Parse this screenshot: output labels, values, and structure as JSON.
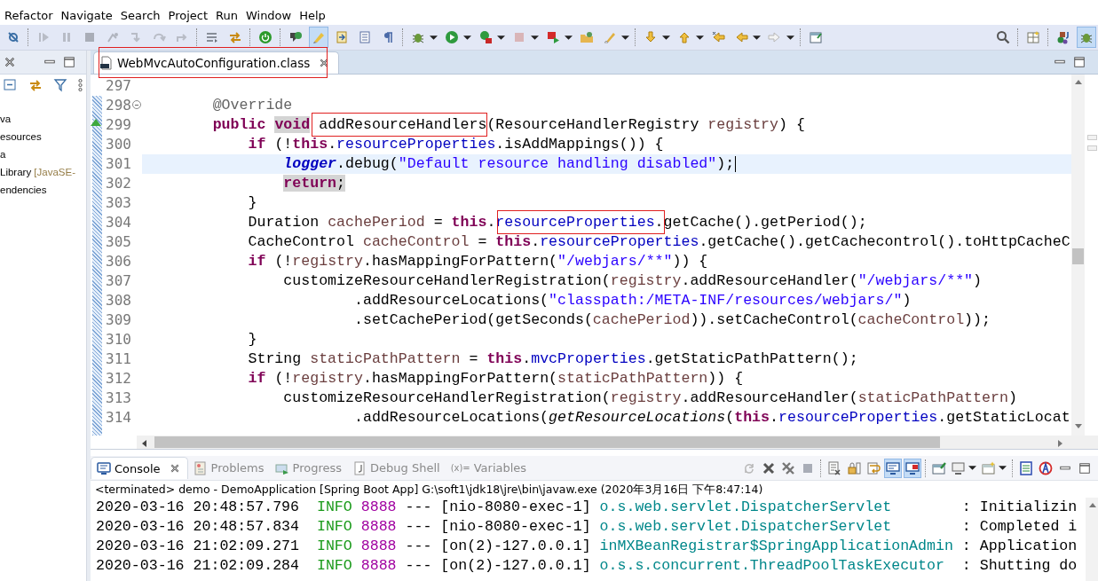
{
  "menu": [
    {
      "label": "Refactor"
    },
    {
      "label": "Navigate"
    },
    {
      "label": "Search"
    },
    {
      "label": "Project"
    },
    {
      "label": "Run"
    },
    {
      "label": "Window"
    },
    {
      "label": "Help"
    }
  ],
  "toolbar": {
    "mark_occurrences": {
      "on": true
    }
  },
  "perspectives": [
    {
      "selected": false
    },
    {
      "selected": false
    },
    {
      "selected": true
    }
  ],
  "left_panel": {
    "items": [
      {
        "text": "va"
      },
      {
        "text": "esources"
      },
      {
        "text": "a"
      },
      {
        "text": " Library",
        "decoration": " [JavaSE-"
      },
      {
        "text": "endencies"
      }
    ]
  },
  "editor": {
    "tabs": [
      {
        "label": "WebMvcAutoConfiguration.class",
        "selected": true,
        "framed": true
      }
    ],
    "lines": [
      {
        "number": "297",
        "current": false
      },
      {
        "number": "298",
        "current": false,
        "fold": {
          "expanded": true
        },
        "tokens": [
          {
            "text": "        @Override",
            "kind": "anno"
          }
        ]
      },
      {
        "number": "299",
        "current": false,
        "override_marker": true,
        "tokens": [
          {
            "text": "        public ",
            "kind": "kw"
          },
          {
            "text": "void",
            "kind": "kw-marked"
          },
          {
            "text": " addResourceHandlers",
            "kind": "plain-framed"
          },
          {
            "text": "(ResourceHandlerRegistry ",
            "kind": "plain"
          },
          {
            "text": "registry",
            "kind": "local"
          },
          {
            "text": ") {",
            "kind": "plain"
          }
        ]
      },
      {
        "number": "300",
        "current": false,
        "tokens": [
          {
            "text": "            if",
            "kind": "kw"
          },
          {
            "text": " (!",
            "kind": "plain"
          },
          {
            "text": "this",
            "kind": "kw"
          },
          {
            "text": ".",
            "kind": "plain"
          },
          {
            "text": "resourceProperties",
            "kind": "field"
          },
          {
            "text": ".isAddMappings()) {",
            "kind": "plain"
          }
        ]
      },
      {
        "number": "301",
        "current": true,
        "tokens": [
          {
            "text": "                logger",
            "kind": "static"
          },
          {
            "text": ".debug(",
            "kind": "plain"
          },
          {
            "text": "\"Default resource handling disabled\"",
            "kind": "str"
          },
          {
            "text": ");",
            "kind": "plain"
          }
        ]
      },
      {
        "number": "302",
        "current": false,
        "tokens": [
          {
            "text": "                return",
            "kind": "kw-marked"
          },
          {
            "text": ";",
            "kind": "plain-marked"
          }
        ]
      },
      {
        "number": "303",
        "current": false,
        "tokens": [
          {
            "text": "            }",
            "kind": "plain"
          }
        ]
      },
      {
        "number": "304",
        "current": false,
        "tokens": [
          {
            "text": "            Duration ",
            "kind": "plain"
          },
          {
            "text": "cachePeriod",
            "kind": "local"
          },
          {
            "text": " = ",
            "kind": "plain"
          },
          {
            "text": "this",
            "kind": "kw"
          },
          {
            "text": ".",
            "kind": "plain"
          },
          {
            "text": "resourceProperties",
            "kind": "field-framed"
          },
          {
            "text": ".",
            "kind": "plain-framed"
          },
          {
            "text": "getCache().getPeriod();",
            "kind": "plain"
          }
        ]
      },
      {
        "number": "305",
        "current": false,
        "tokens": [
          {
            "text": "            CacheControl ",
            "kind": "plain"
          },
          {
            "text": "cacheControl",
            "kind": "local"
          },
          {
            "text": " = ",
            "kind": "plain"
          },
          {
            "text": "this",
            "kind": "kw"
          },
          {
            "text": ".",
            "kind": "plain"
          },
          {
            "text": "resourceProperties",
            "kind": "field"
          },
          {
            "text": ".getCache().getCachecontrol().toHttpCacheC",
            "kind": "plain"
          }
        ]
      },
      {
        "number": "306",
        "current": false,
        "tokens": [
          {
            "text": "            if",
            "kind": "kw"
          },
          {
            "text": " (!",
            "kind": "plain"
          },
          {
            "text": "registry",
            "kind": "local"
          },
          {
            "text": ".hasMappingForPattern(",
            "kind": "plain"
          },
          {
            "text": "\"/webjars/**\"",
            "kind": "str"
          },
          {
            "text": ")) {",
            "kind": "plain"
          }
        ]
      },
      {
        "number": "307",
        "current": false,
        "tokens": [
          {
            "text": "                customizeResourceHandlerRegistration(",
            "kind": "plain"
          },
          {
            "text": "registry",
            "kind": "local"
          },
          {
            "text": ".addResourceHandler(",
            "kind": "plain"
          },
          {
            "text": "\"/webjars/**\"",
            "kind": "str"
          },
          {
            "text": ")",
            "kind": "plain"
          }
        ]
      },
      {
        "number": "308",
        "current": false,
        "tokens": [
          {
            "text": "                        .addResourceLocations(",
            "kind": "plain"
          },
          {
            "text": "\"classpath:/META-INF/resources/webjars/\"",
            "kind": "str"
          },
          {
            "text": ")",
            "kind": "plain"
          }
        ]
      },
      {
        "number": "309",
        "current": false,
        "tokens": [
          {
            "text": "                        .setCachePeriod(getSeconds(",
            "kind": "plain"
          },
          {
            "text": "cachePeriod",
            "kind": "local"
          },
          {
            "text": ")).setCacheControl(",
            "kind": "plain"
          },
          {
            "text": "cacheControl",
            "kind": "local"
          },
          {
            "text": "));",
            "kind": "plain"
          }
        ]
      },
      {
        "number": "310",
        "current": false,
        "tokens": [
          {
            "text": "            }",
            "kind": "plain"
          }
        ]
      },
      {
        "number": "311",
        "current": false,
        "tokens": [
          {
            "text": "            String ",
            "kind": "plain"
          },
          {
            "text": "staticPathPattern",
            "kind": "local"
          },
          {
            "text": " = ",
            "kind": "plain"
          },
          {
            "text": "this",
            "kind": "kw"
          },
          {
            "text": ".",
            "kind": "plain"
          },
          {
            "text": "mvcProperties",
            "kind": "field"
          },
          {
            "text": ".getStaticPathPattern();",
            "kind": "plain"
          }
        ]
      },
      {
        "number": "312",
        "current": false,
        "tokens": [
          {
            "text": "            if",
            "kind": "kw"
          },
          {
            "text": " (!",
            "kind": "plain"
          },
          {
            "text": "registry",
            "kind": "local"
          },
          {
            "text": ".hasMappingForPattern(",
            "kind": "plain"
          },
          {
            "text": "staticPathPattern",
            "kind": "local"
          },
          {
            "text": ")) {",
            "kind": "plain"
          }
        ]
      },
      {
        "number": "313",
        "current": false,
        "tokens": [
          {
            "text": "                customizeResourceHandlerRegistration(",
            "kind": "plain"
          },
          {
            "text": "registry",
            "kind": "local"
          },
          {
            "text": ".addResourceHandler(",
            "kind": "plain"
          },
          {
            "text": "staticPathPattern",
            "kind": "local"
          },
          {
            "text": ")",
            "kind": "plain"
          }
        ]
      },
      {
        "number": "314",
        "current": false,
        "tokens": [
          {
            "text": "                        .addResourceLocations(",
            "kind": "plain"
          },
          {
            "text": "getResourceLocations",
            "kind": "italic"
          },
          {
            "text": "(",
            "kind": "plain"
          },
          {
            "text": "this",
            "kind": "kw"
          },
          {
            "text": ".",
            "kind": "plain"
          },
          {
            "text": "resourceProperties",
            "kind": "field"
          },
          {
            "text": ".getStaticLocat",
            "kind": "plain"
          }
        ]
      }
    ]
  },
  "console": {
    "tabs": [
      {
        "label": "Console",
        "selected": true,
        "closable": true
      },
      {
        "label": "Problems",
        "selected": false,
        "closable": false
      },
      {
        "label": "Progress",
        "selected": false,
        "closable": false
      },
      {
        "label": "Debug Shell",
        "selected": false,
        "closable": false
      },
      {
        "label": "Variables",
        "icon_text": "(x)=",
        "selected": false,
        "closable": false
      }
    ],
    "toolbar": {
      "show_on_output": {
        "on": true
      },
      "show_on_error": {
        "on": true
      }
    },
    "header": "<terminated> demo - DemoApplication [Spring Boot App] G:\\soft1\\jdk18\\jre\\bin\\javaw.exe (2020年3月16日 下午8:47:14)",
    "rows": [
      {
        "timestamp": "2020-03-16 20:48:57.796",
        "level": "INFO",
        "pid": "8888",
        "separator": "---",
        "thread": "[nio-8080-exec-1]",
        "logger": "o.s.web.servlet.DispatcherServlet",
        "message": ": Initializin"
      },
      {
        "timestamp": "2020-03-16 20:48:57.834",
        "level": "INFO",
        "pid": "8888",
        "separator": "---",
        "thread": "[nio-8080-exec-1]",
        "logger": "o.s.web.servlet.DispatcherServlet",
        "message": ": Completed i"
      },
      {
        "timestamp": "2020-03-16 21:02:09.271",
        "level": "INFO",
        "pid": "8888",
        "separator": "---",
        "thread": "[on(2)-127.0.0.1]",
        "logger": "inMXBeanRegistrar$SpringApplicationAdmin",
        "message": ": Application"
      },
      {
        "timestamp": "2020-03-16 21:02:09.284",
        "level": "INFO",
        "pid": "8888",
        "separator": "---",
        "thread": "[on(2)-127.0.0.1]",
        "logger": "o.s.s.concurrent.ThreadPoolTaskExecutor",
        "message": ": Shutting do"
      }
    ]
  }
}
